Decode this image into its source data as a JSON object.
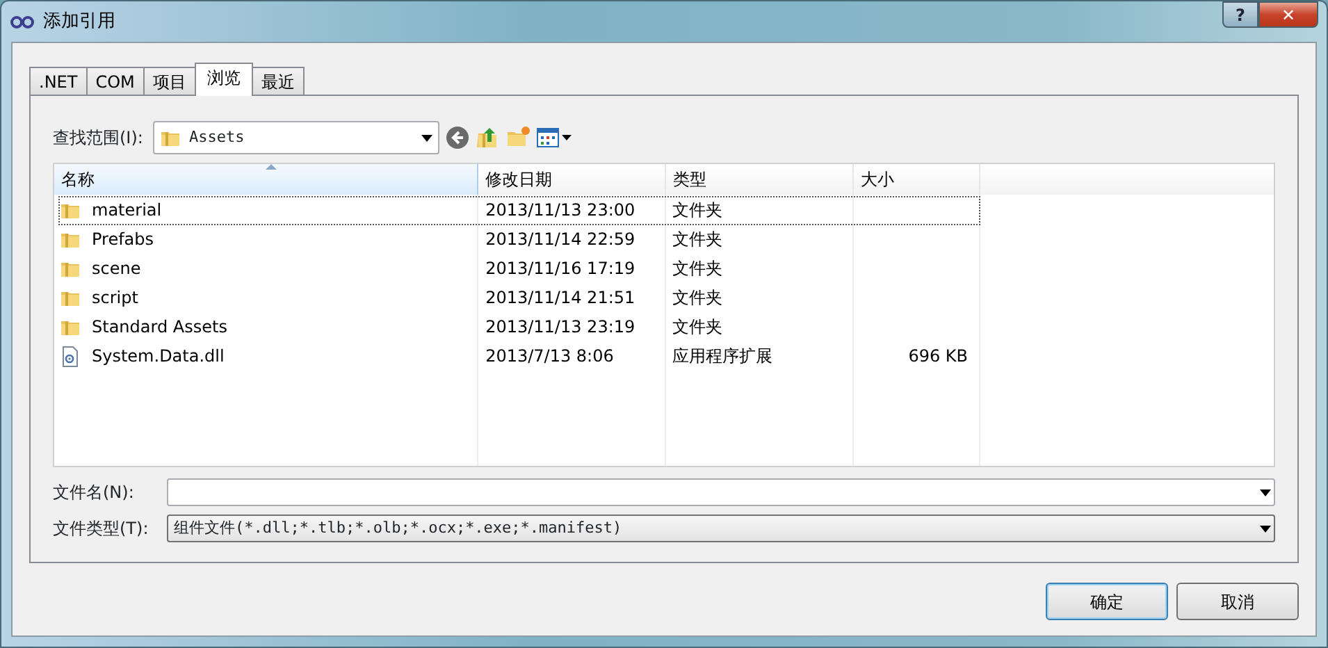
{
  "window": {
    "title": "添加引用",
    "help_label": "?",
    "close_label": "✕"
  },
  "tabs": [
    {
      "label": ".NET",
      "selected": false
    },
    {
      "label": "COM",
      "selected": false
    },
    {
      "label": "项目",
      "selected": false
    },
    {
      "label": "浏览",
      "selected": true
    },
    {
      "label": "最近",
      "selected": false
    }
  ],
  "look_in": {
    "label": "查找范围(I):",
    "value": "Assets"
  },
  "file_list": {
    "columns": [
      {
        "label": "名称",
        "sorted": true
      },
      {
        "label": "修改日期",
        "sorted": false
      },
      {
        "label": "类型",
        "sorted": false
      },
      {
        "label": "大小",
        "sorted": false
      }
    ],
    "rows": [
      {
        "kind": "folder",
        "name": "material",
        "modified": "2013/11/13 23:00",
        "type": "文件夹",
        "focused": true
      },
      {
        "kind": "folder",
        "name": "Prefabs",
        "modified": "2013/11/14 22:59",
        "type": "文件夹",
        "focused": false
      },
      {
        "kind": "folder",
        "name": "scene",
        "modified": "2013/11/16 17:19",
        "type": "文件夹",
        "focused": false
      },
      {
        "kind": "folder",
        "name": "script",
        "modified": "2013/11/14 21:51",
        "type": "文件夹",
        "focused": false
      },
      {
        "kind": "folder",
        "name": "Standard Assets",
        "modified": "2013/11/13 23:19",
        "type": "文件夹",
        "focused": false
      },
      {
        "kind": "file",
        "name": "System.Data.dll",
        "modified": "2013/7/13 8:06",
        "type": "应用程序扩展",
        "size": "696 KB",
        "focused": false
      }
    ]
  },
  "file_name": {
    "label": "文件名(N):"
  },
  "file_type": {
    "label": "文件类型(T):",
    "value": "组件文件(*.dll;*.tlb;*.olb;*.ocx;*.exe;*.manifest)"
  },
  "buttons": [
    {
      "label": "确定",
      "default": true
    },
    {
      "label": "取消",
      "default": false
    }
  ]
}
